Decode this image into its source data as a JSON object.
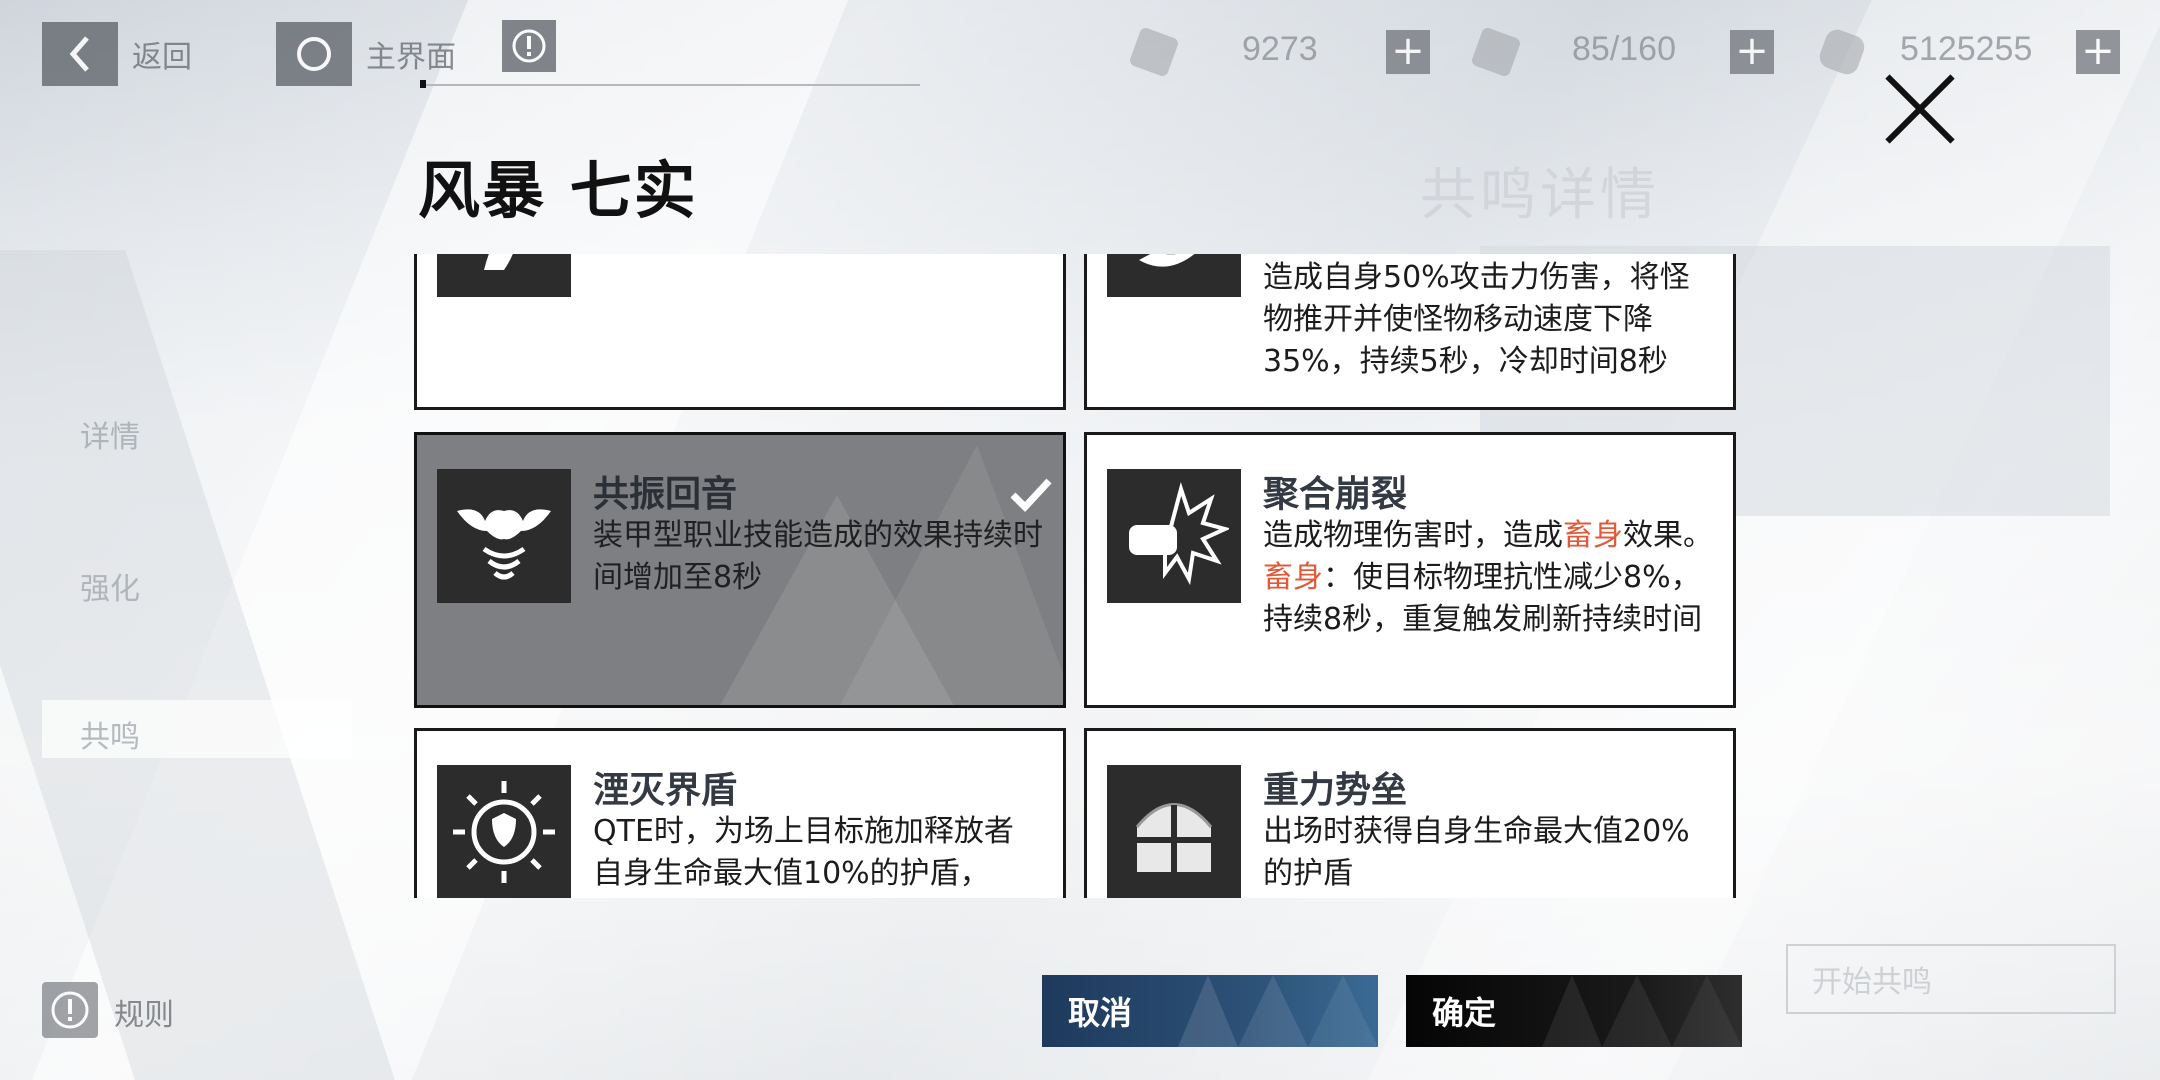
{
  "topbar": {
    "back_label": "返回",
    "home_label": "主界面",
    "resources": [
      {
        "icon": "stamina-card-icon",
        "value": "9273"
      },
      {
        "icon": "key-icon",
        "value": "85/160"
      },
      {
        "icon": "coin-icon",
        "value": "5125255"
      }
    ]
  },
  "sidebar": {
    "items": [
      {
        "label": "详情"
      },
      {
        "label": "强化"
      },
      {
        "label": "共鸣"
      }
    ],
    "rules_label": "规则"
  },
  "background": {
    "title": "共鸣详情",
    "start_label": "开始共鸣"
  },
  "popup": {
    "title": "风暴 七实",
    "cards": [
      {
        "name": "",
        "desc": ""
      },
      {
        "name": "",
        "desc": "造成自身50%攻击力伤害，将怪物推开并使怪物移动速度下降35%，持续5秒，冷却时间8秒"
      },
      {
        "name": "共振回音",
        "desc": "装甲型职业技能造成的效果持续时间增加至8秒",
        "selected": true
      },
      {
        "name": "聚合崩裂",
        "desc_parts": [
          "造成物理伤害时，造成",
          "畜身",
          "效果。",
          "畜身",
          "：使目标物理抗性减少8%，持续8秒，重复触发刷新持续时间"
        ]
      },
      {
        "name": "湮灭界盾",
        "desc": "QTE时，为场上目标施加释放者自身生命最大值10%的护盾，"
      },
      {
        "name": "重力势垒",
        "desc": "出场时获得自身生命最大值20%的护盾"
      }
    ],
    "cancel_label": "取消",
    "confirm_label": "确定"
  },
  "colors": {
    "highlight": "#e05a3a",
    "cancel_button": "#2c5076",
    "confirm_button": "#111111"
  }
}
